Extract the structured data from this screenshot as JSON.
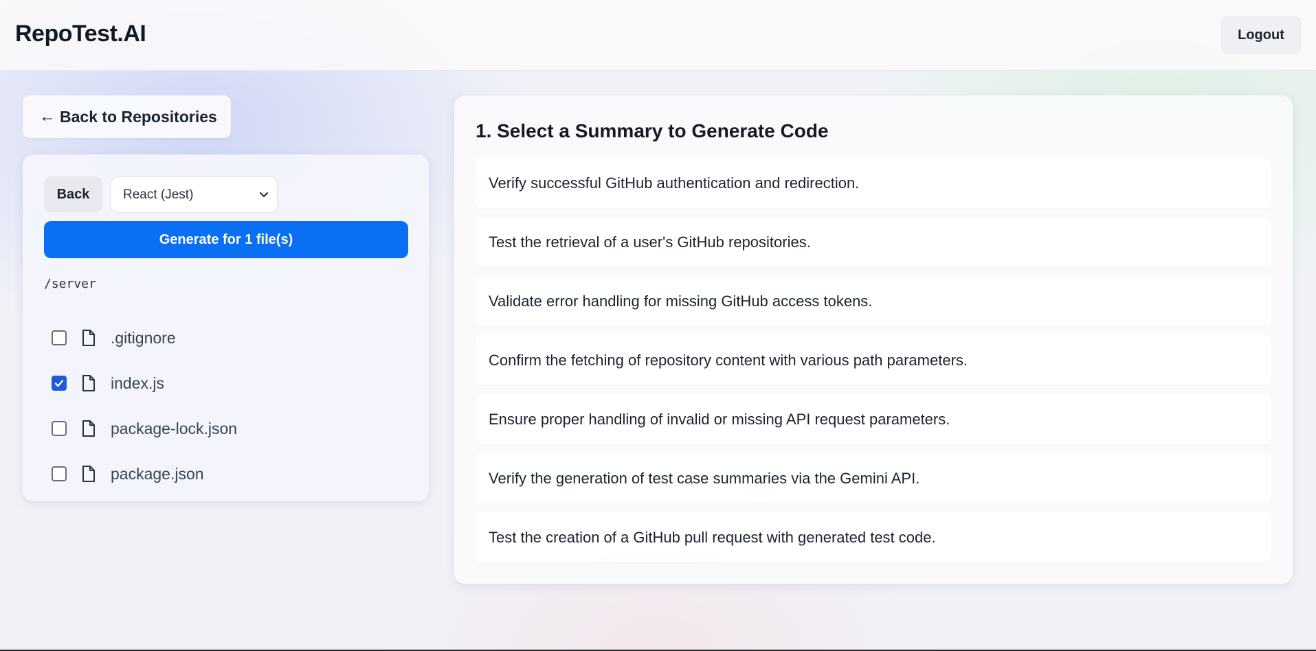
{
  "header": {
    "brand": "RepoTest.AI",
    "logout_label": "Logout"
  },
  "nav": {
    "back_to_repos_label": "Back to Repositories"
  },
  "left_panel": {
    "back_label": "Back",
    "framework_select": {
      "selected": "React (Jest)"
    },
    "generate_label": "Generate for 1 file(s)",
    "path": "/server",
    "files": [
      {
        "name": ".gitignore",
        "checked": false
      },
      {
        "name": "index.js",
        "checked": true
      },
      {
        "name": "package-lock.json",
        "checked": false
      },
      {
        "name": "package.json",
        "checked": false
      }
    ]
  },
  "right_panel": {
    "title": "1. Select a Summary to Generate Code",
    "summaries": [
      "Verify successful GitHub authentication and redirection.",
      "Test the retrieval of a user's GitHub repositories.",
      "Validate error handling for missing GitHub access tokens.",
      "Confirm the fetching of repository content with various path parameters.",
      "Ensure proper handling of invalid or missing API request parameters.",
      "Verify the generation of test case summaries via the Gemini API.",
      "Test the creation of a GitHub pull request with generated test code."
    ]
  },
  "colors": {
    "primary": "#0a6ff2",
    "checkbox_checked": "#1e5bd4"
  }
}
